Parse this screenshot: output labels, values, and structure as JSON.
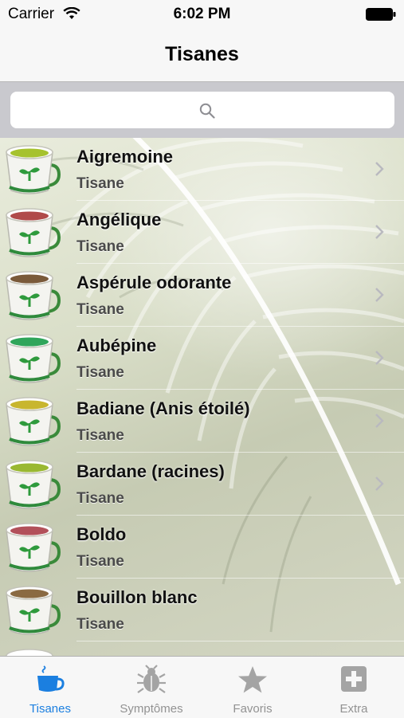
{
  "status": {
    "carrier": "Carrier",
    "time": "6:02 PM"
  },
  "nav": {
    "title": "Tisanes"
  },
  "search": {
    "placeholder": ""
  },
  "list": {
    "items": [
      {
        "title": "Aigremoine",
        "subtitle": "Tisane",
        "tea_color": "#a6c22e"
      },
      {
        "title": "Angélique",
        "subtitle": "Tisane",
        "tea_color": "#b04a4a"
      },
      {
        "title": "Aspérule odorante",
        "subtitle": "Tisane",
        "tea_color": "#7a5a3a"
      },
      {
        "title": "Aubépine",
        "subtitle": "Tisane",
        "tea_color": "#2fa55a"
      },
      {
        "title": "Badiane (Anis étoilé)",
        "subtitle": "Tisane",
        "tea_color": "#c8b62e"
      },
      {
        "title": "Bardane (racines)",
        "subtitle": "Tisane",
        "tea_color": "#9ab832"
      },
      {
        "title": "Boldo",
        "subtitle": "Tisane",
        "tea_color": "#b2505a"
      },
      {
        "title": "Bouillon blanc",
        "subtitle": "Tisane",
        "tea_color": "#8a6a42"
      }
    ]
  },
  "tabs": [
    {
      "label": "Tisanes",
      "icon": "teacup-icon",
      "active": true
    },
    {
      "label": "Symptômes",
      "icon": "bug-icon",
      "active": false
    },
    {
      "label": "Favoris",
      "icon": "star-icon",
      "active": false
    },
    {
      "label": "Extra",
      "icon": "plus-box-icon",
      "active": false
    }
  ],
  "colors": {
    "accent": "#1b7fe0",
    "inactive": "#929292"
  }
}
